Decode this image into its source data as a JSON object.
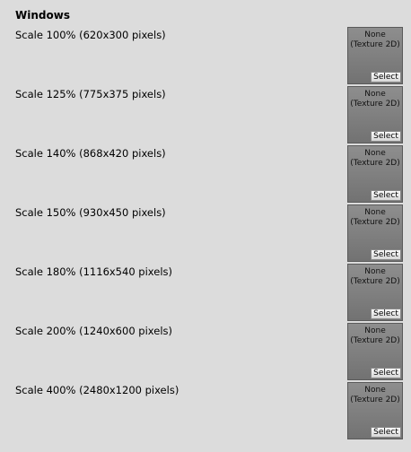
{
  "title": "Windows",
  "rows": [
    {
      "label": "Scale 100% (620x300 pixels)",
      "texture": "None\n(Texture 2D)",
      "button": "Select"
    },
    {
      "label": "Scale 125% (775x375 pixels)",
      "texture": "None\n(Texture 2D)",
      "button": "Select"
    },
    {
      "label": "Scale 140% (868x420 pixels)",
      "texture": "None\n(Texture 2D)",
      "button": "Select"
    },
    {
      "label": "Scale 150% (930x450 pixels)",
      "texture": "None\n(Texture 2D)",
      "button": "Select"
    },
    {
      "label": "Scale 180% (1116x540 pixels)",
      "texture": "None\n(Texture 2D)",
      "button": "Select"
    },
    {
      "label": "Scale 200% (1240x600 pixels)",
      "texture": "None\n(Texture 2D)",
      "button": "Select"
    },
    {
      "label": "Scale 400% (2480x1200 pixels)",
      "texture": "None\n(Texture 2D)",
      "button": "Select"
    }
  ]
}
